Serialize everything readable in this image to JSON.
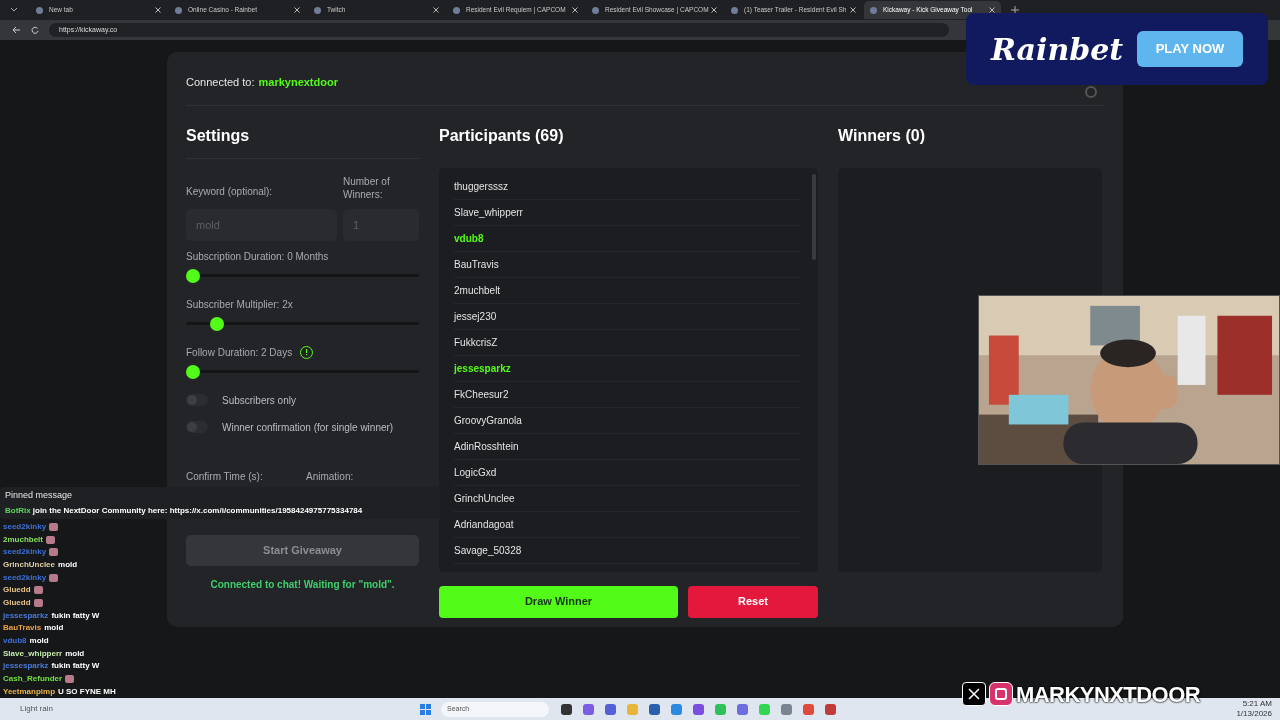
{
  "browser": {
    "tabs": [
      {
        "title": "New tab",
        "selected": false
      },
      {
        "title": "Online Casino - Rainbet",
        "selected": false
      },
      {
        "title": "Twitch",
        "selected": false
      },
      {
        "title": "Resident Evil Requiem | CAPCOM",
        "selected": false
      },
      {
        "title": "Resident Evil Showcase | CAPCOM",
        "selected": false
      },
      {
        "title": "(1) Teaser Trailer - Resident Evil Sh",
        "selected": false
      },
      {
        "title": "Kickaway - Kick Giveaway Tool",
        "selected": true
      }
    ],
    "url": "https://kickaway.co"
  },
  "connection": {
    "label": "Connected to:",
    "channel": "markynextdoor"
  },
  "settings": {
    "title": "Settings",
    "keyword": {
      "label": "Keyword (optional):",
      "placeholder": "mold"
    },
    "winners_count": {
      "label": "Number of Winners:",
      "placeholder": "1"
    },
    "sliders": [
      {
        "label": "Subscription Duration: 0 Months",
        "level": 0,
        "info": false
      },
      {
        "label": "Subscriber Multiplier: 2x",
        "level": 0.11,
        "info": false
      },
      {
        "label": "Follow Duration: 2 Days",
        "level": 0,
        "info": true
      }
    ],
    "toggles": [
      {
        "label": "Subscribers only",
        "on": false
      },
      {
        "label": "Winner confirmation (for single winner)",
        "on": false
      }
    ],
    "confirm_time_label": "Confirm Time (s):",
    "animation_label": "Animation:",
    "start_button": "Start Giveaway",
    "status": "Connected to chat! Waiting for \"mold\"."
  },
  "participants": {
    "title": "Participants (69)",
    "items": [
      {
        "name": "thuggersssz",
        "subscriber": false
      },
      {
        "name": "Slave_whipperr",
        "subscriber": false
      },
      {
        "name": "vdub8",
        "subscriber": true
      },
      {
        "name": "BauTravis",
        "subscriber": false
      },
      {
        "name": "2muchbelt",
        "subscriber": false
      },
      {
        "name": "jessej230",
        "subscriber": false
      },
      {
        "name": "FukkcrisZ",
        "subscriber": false
      },
      {
        "name": "jessesparkz",
        "subscriber": true
      },
      {
        "name": "FkCheesur2",
        "subscriber": false
      },
      {
        "name": "GroovyGranola",
        "subscriber": false
      },
      {
        "name": "AdinRosshtein",
        "subscriber": false
      },
      {
        "name": "LogicGxd",
        "subscriber": false
      },
      {
        "name": "GrinchUnclee",
        "subscriber": false
      },
      {
        "name": "Adriandagoat",
        "subscriber": false
      },
      {
        "name": "Savage_50328",
        "subscriber": false
      }
    ],
    "draw_button": "Draw Winner",
    "reset_button": "Reset"
  },
  "winners": {
    "title": "Winners (0)"
  },
  "chat_overlay": {
    "pinned_title": "Pinned message",
    "pinned": {
      "user": "BotRix",
      "color": "#5fd35f",
      "text": "join the NextDoor Community here: https://x.com/i/communities/1958424975775334784"
    },
    "messages": [
      {
        "user": "seed2kinky",
        "color": "#3d6fd8",
        "kind": "emote"
      },
      {
        "user": "2muchbelt",
        "color": "#86e05a",
        "kind": "emote"
      },
      {
        "user": "seed2kinky",
        "color": "#3d6fd8",
        "kind": "emote"
      },
      {
        "user": "GrinchUnclee",
        "color": "#e2cfa6",
        "kind": "text",
        "text": "mold"
      },
      {
        "user": "seed2kinky",
        "color": "#3d6fd8",
        "kind": "emote"
      },
      {
        "user": "Gluedd",
        "color": "#e6c486",
        "kind": "emote"
      },
      {
        "user": "Gluedd",
        "color": "#e6c486",
        "kind": "emote"
      },
      {
        "user": "jessesparkz",
        "color": "#4a7ad8",
        "kind": "text",
        "text": "fukin fatty W"
      },
      {
        "user": "BauTravis",
        "color": "#eba245",
        "kind": "text",
        "text": "mold"
      },
      {
        "user": "vdub8",
        "color": "#3d6fd8",
        "kind": "text",
        "text": "mold"
      },
      {
        "user": "Slave_whipperr",
        "color": "#c3ebaa",
        "kind": "text",
        "text": "mold"
      },
      {
        "user": "jessesparkz",
        "color": "#4a7ad8",
        "kind": "text",
        "text": "fukin fatty W"
      },
      {
        "user": "Cash_Refunder",
        "color": "#6fe040",
        "kind": "emote"
      },
      {
        "user": "Yeetmanpimp",
        "color": "#ebb545",
        "kind": "text",
        "text": "U SO FYNE MH"
      }
    ]
  },
  "ad": {
    "brand": "Rainbet",
    "button": "PLAY NOW"
  },
  "social": {
    "handle": "MARKYNXTDOOR"
  },
  "taskbar": {
    "weather": "Light rain",
    "search_placeholder": "Search",
    "time": "5:21 AM",
    "date": "1/13/2026"
  }
}
